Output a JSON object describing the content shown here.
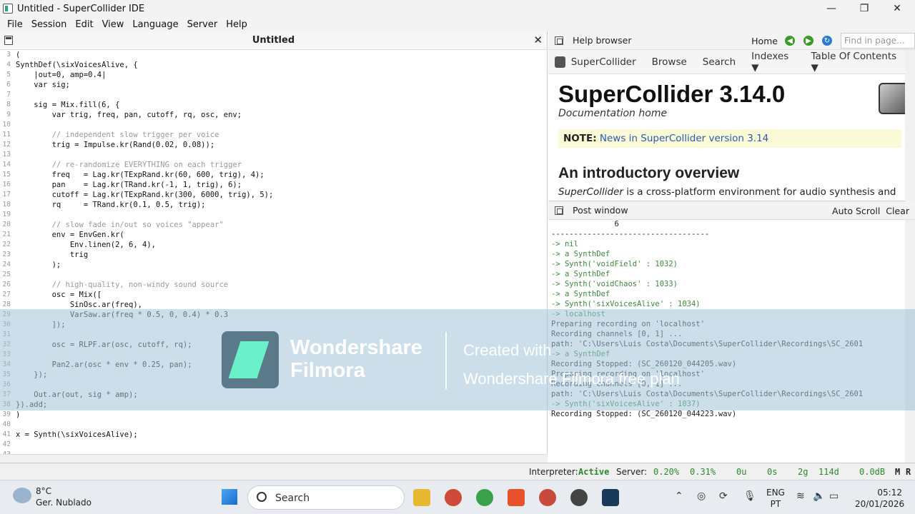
{
  "window": {
    "title": "Untitled - SuperCollider IDE",
    "minimize": "—",
    "maximize": "❐",
    "close": "✕"
  },
  "menu": [
    "File",
    "Session",
    "Edit",
    "View",
    "Language",
    "Server",
    "Help"
  ],
  "editor": {
    "tab_title": "Untitled",
    "close": "✕",
    "lines": [
      {
        "n": "3",
        "t": "("
      },
      {
        "n": "4",
        "t": "SynthDef(\\sixVoicesAlive, {"
      },
      {
        "n": "5",
        "t": "    |out=0, amp=0.4|"
      },
      {
        "n": "6",
        "t": "    var sig;"
      },
      {
        "n": "7",
        "t": ""
      },
      {
        "n": "8",
        "t": "    sig = Mix.fill(6, {"
      },
      {
        "n": "9",
        "t": "        var trig, freq, pan, cutoff, rq, osc, env;"
      },
      {
        "n": "10",
        "t": ""
      },
      {
        "n": "11",
        "t": "        // independent slow trigger per voice"
      },
      {
        "n": "12",
        "t": "        trig = Impulse.kr(Rand(0.02, 0.08));"
      },
      {
        "n": "13",
        "t": ""
      },
      {
        "n": "14",
        "t": "        // re-randomize EVERYTHING on each trigger"
      },
      {
        "n": "15",
        "t": "        freq   = Lag.kr(TExpRand.kr(60, 600, trig), 4);"
      },
      {
        "n": "16",
        "t": "        pan    = Lag.kr(TRand.kr(-1, 1, trig), 6);"
      },
      {
        "n": "17",
        "t": "        cutoff = Lag.kr(TExpRand.kr(300, 6000, trig), 5);"
      },
      {
        "n": "18",
        "t": "        rq     = TRand.kr(0.1, 0.5, trig);"
      },
      {
        "n": "19",
        "t": ""
      },
      {
        "n": "20",
        "t": "        // slow fade in/out so voices \"appear\""
      },
      {
        "n": "21",
        "t": "        env = EnvGen.kr("
      },
      {
        "n": "22",
        "t": "            Env.linen(2, 6, 4),"
      },
      {
        "n": "23",
        "t": "            trig"
      },
      {
        "n": "24",
        "t": "        );"
      },
      {
        "n": "25",
        "t": ""
      },
      {
        "n": "26",
        "t": "        // high-quality, non-windy sound source"
      },
      {
        "n": "27",
        "t": "        osc = Mix(["
      },
      {
        "n": "28",
        "t": "            SinOsc.ar(freq),"
      },
      {
        "n": "29",
        "t": "            VarSaw.ar(freq * 0.5, 0, 0.4) * 0.3"
      },
      {
        "n": "30",
        "t": "        ]);"
      },
      {
        "n": "31",
        "t": ""
      },
      {
        "n": "32",
        "t": "        osc = RLPF.ar(osc, cutoff, rq);"
      },
      {
        "n": "33",
        "t": ""
      },
      {
        "n": "34",
        "t": "        Pan2.ar(osc * env * 0.25, pan);"
      },
      {
        "n": "35",
        "t": "    });"
      },
      {
        "n": "36",
        "t": ""
      },
      {
        "n": "37",
        "t": "    Out.ar(out, sig * amp);"
      },
      {
        "n": "38",
        "t": "}).add;"
      },
      {
        "n": "39",
        "t": ")"
      },
      {
        "n": "40",
        "t": ""
      },
      {
        "n": "41",
        "t": "x = Synth(\\sixVoicesAlive);"
      },
      {
        "n": "42",
        "t": ""
      },
      {
        "n": "43",
        "t": ""
      }
    ]
  },
  "help_browser": {
    "title": "Help browser",
    "home": "Home",
    "find_placeholder": "Find in page...",
    "nav": [
      "SuperCollider",
      "Browse",
      "Search",
      "Indexes ▼",
      "Table Of Contents ▼"
    ],
    "heading": "SuperCollider 3.14.0",
    "subheading": "Documentation home",
    "note_label": "NOTE:",
    "note_link": "News in SuperCollider version 3.14",
    "section": "An introductory overview",
    "para_em": "SuperCollider",
    "para": " is a cross-platform environment for audio synthesis and"
  },
  "post_window": {
    "title": "Post window",
    "auto_scroll": "Auto Scroll",
    "clear": "Clear",
    "lines": [
      {
        "t": "              6",
        "g": false
      },
      {
        "t": "-----------------------------------",
        "g": false
      },
      {
        "t": "-> nil",
        "g": true
      },
      {
        "t": "-> a SynthDef",
        "g": true
      },
      {
        "t": "-> Synth('voidField' : 1032)",
        "g": true
      },
      {
        "t": "-> a SynthDef",
        "g": true
      },
      {
        "t": "-> Synth('voidChaos' : 1033)",
        "g": true
      },
      {
        "t": "-> a SynthDef",
        "g": true
      },
      {
        "t": "-> Synth('sixVoicesAlive' : 1034)",
        "g": true
      },
      {
        "t": "-> localhost",
        "g": true
      },
      {
        "t": "Preparing recording on 'localhost'",
        "g": false
      },
      {
        "t": "Recording channels [0, 1] ...",
        "g": false
      },
      {
        "t": "path: 'C:\\Users\\Luis Costa\\Documents\\SuperCollider\\Recordings\\SC_2601",
        "g": false
      },
      {
        "t": "-> a SynthDef",
        "g": true
      },
      {
        "t": "Recording Stopped: (SC_260120_044205.wav)",
        "g": false
      },
      {
        "t": "Preparing recording on 'localhost'",
        "g": false
      },
      {
        "t": "Recording channels [0, 1] ...",
        "g": false
      },
      {
        "t": "path: 'C:\\Users\\Luis Costa\\Documents\\SuperCollider\\Recordings\\SC_2601",
        "g": false
      },
      {
        "t": "-> Synth('sixVoicesAlive' : 1037)",
        "g": true
      },
      {
        "t": "Recording Stopped: (SC_260120_044223.wav)",
        "g": false
      }
    ]
  },
  "status": {
    "interpreter_label": "Interpreter:",
    "interpreter_state": "Active",
    "server_label": "Server:",
    "avg_cpu": "0.20%",
    "peak_cpu": "0.31%",
    "ugens": "0u",
    "synths": "0s",
    "groups": "2g",
    "defs": "114d",
    "volume": "0.0dB",
    "mute": "M",
    "rec": "R"
  },
  "watermark": {
    "brand1": "Wondershare",
    "brand2": "Filmora",
    "line1": "Created with",
    "line2": "Wondershare Filmora free plan"
  },
  "taskbar": {
    "temp": "8°C",
    "condition": "Ger. Nublado",
    "search": "Search",
    "lang1": "ENG",
    "lang2": "PT",
    "time": "05:12",
    "date": "20/01/2026"
  }
}
